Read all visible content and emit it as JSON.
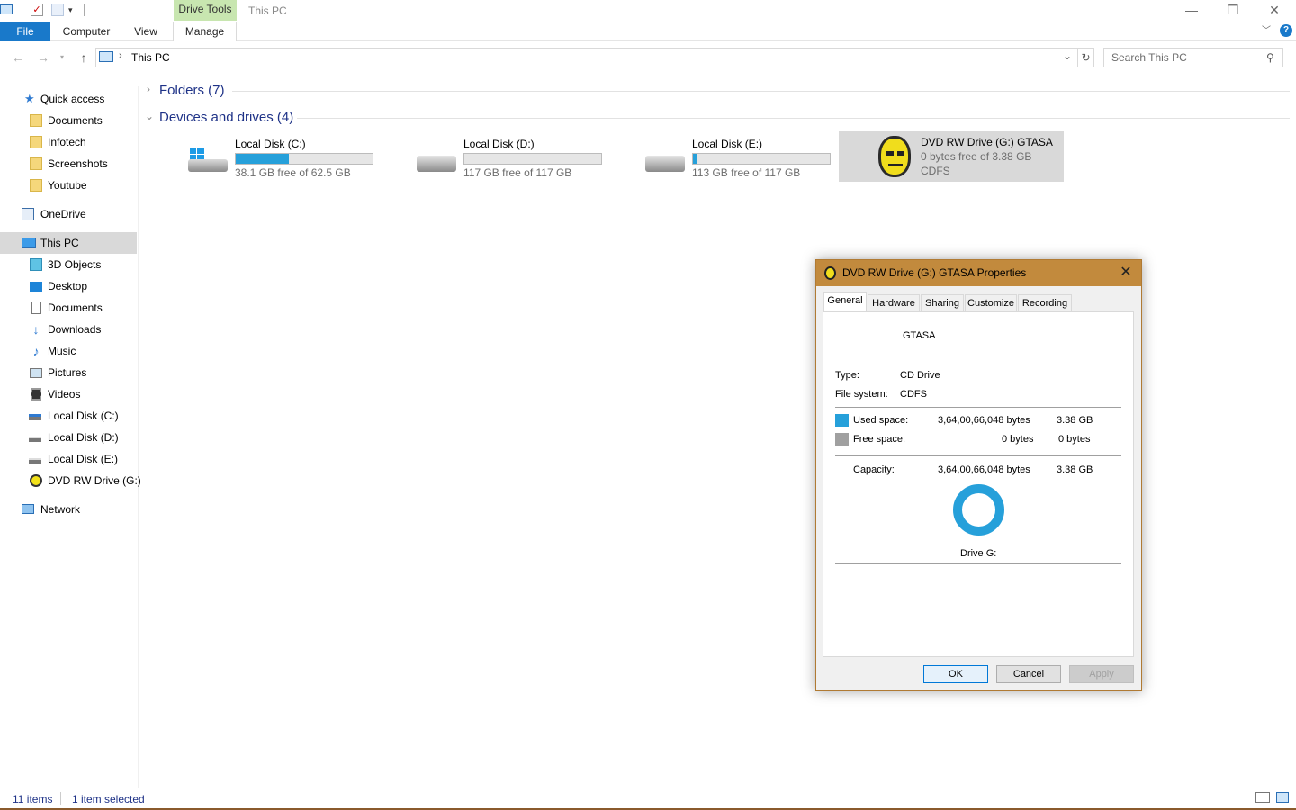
{
  "window": {
    "title": "This PC",
    "drive_tools": "Drive Tools",
    "minimize": "—",
    "restore": "❐",
    "close": "✕"
  },
  "ribbon": {
    "tabs": [
      "File",
      "Computer",
      "View",
      "Manage"
    ],
    "help": "?"
  },
  "address": {
    "path": "This PC",
    "search_placeholder": "Search This PC"
  },
  "sidebar": {
    "items": [
      {
        "label": "Quick access",
        "icon": "star-icon"
      },
      {
        "label": "Documents",
        "icon": "folder-icon"
      },
      {
        "label": "Infotech",
        "icon": "folder-icon"
      },
      {
        "label": "Screenshots",
        "icon": "folder-icon"
      },
      {
        "label": "Youtube",
        "icon": "folder-icon"
      },
      {
        "label": "OneDrive",
        "icon": "onedrive-icon"
      },
      {
        "label": "This PC",
        "icon": "computer-icon"
      },
      {
        "label": "3D Objects",
        "icon": "cube-icon"
      },
      {
        "label": "Desktop",
        "icon": "desktop-icon"
      },
      {
        "label": "Documents",
        "icon": "documents-icon"
      },
      {
        "label": "Downloads",
        "icon": "download-icon"
      },
      {
        "label": "Music",
        "icon": "music-icon"
      },
      {
        "label": "Pictures",
        "icon": "pictures-icon"
      },
      {
        "label": "Videos",
        "icon": "videos-icon"
      },
      {
        "label": "Local Disk (C:)",
        "icon": "drive-icon"
      },
      {
        "label": "Local Disk (D:)",
        "icon": "drive-icon"
      },
      {
        "label": "Local Disk (E:)",
        "icon": "drive-icon"
      },
      {
        "label": "DVD RW Drive (G:)",
        "icon": "dvd-icon"
      },
      {
        "label": "Network",
        "icon": "network-icon"
      }
    ]
  },
  "main": {
    "folders_group": "Folders (7)",
    "devices_group": "Devices and drives (4)",
    "drives": [
      {
        "name": "Local Disk (C:)",
        "free": "38.1 GB free of 62.5 GB",
        "used_fraction": 0.39
      },
      {
        "name": "Local Disk (D:)",
        "free": "117 GB free of 117 GB",
        "used_fraction": 0.0
      },
      {
        "name": "Local Disk (E:)",
        "free": "113 GB free of 117 GB",
        "used_fraction": 0.03
      },
      {
        "name": "DVD RW Drive (G:) GTASA",
        "free": "0 bytes free of 3.38 GB",
        "fs": "CDFS"
      }
    ]
  },
  "status": {
    "items": "11 items",
    "selected": "1 item selected"
  },
  "dialog": {
    "title": "DVD RW Drive (G:) GTASA Properties",
    "tabs": [
      "General",
      "Hardware",
      "Sharing",
      "Customize",
      "Recording"
    ],
    "label": "GTASA",
    "type_label": "Type:",
    "type_value": "CD Drive",
    "fs_label": "File system:",
    "fs_value": "CDFS",
    "used_label": "Used space:",
    "used_bytes": "3,64,00,66,048 bytes",
    "used_size": "3.38 GB",
    "free_label": "Free space:",
    "free_bytes": "0 bytes",
    "free_size": "0 bytes",
    "cap_label": "Capacity:",
    "cap_bytes": "3,64,00,66,048 bytes",
    "cap_size": "3.38 GB",
    "drive_label": "Drive G:",
    "ok": "OK",
    "cancel": "Cancel",
    "apply": "Apply",
    "used_color": "#26a0da",
    "free_color": "#a0a0a0"
  }
}
